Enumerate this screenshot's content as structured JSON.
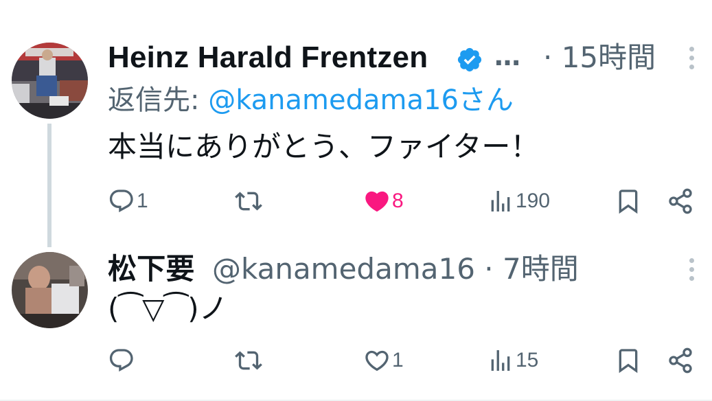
{
  "tweets": [
    {
      "author_name": "Heinz Harald Frentzen",
      "verified": true,
      "ellipsis": "…",
      "time": "· 15時間",
      "reply_prefix": "返信先: ",
      "reply_handle": "@kanamedama16さん",
      "text": "本当にありがとう、ファイター！",
      "replies": "1",
      "reposts": "",
      "likes": "8",
      "liked": true,
      "views": "190"
    },
    {
      "author_name": "松下要",
      "handle_time": "@kanamedama16 · 7時間",
      "text": "(⁀▽⁀)ノ",
      "replies": "",
      "reposts": "",
      "likes": "1",
      "liked": false,
      "views": "15"
    }
  ],
  "colors": {
    "like_active": "#f91880",
    "link": "#1d9bf0",
    "secondary": "#536471",
    "verified": "#1d9bf0"
  }
}
